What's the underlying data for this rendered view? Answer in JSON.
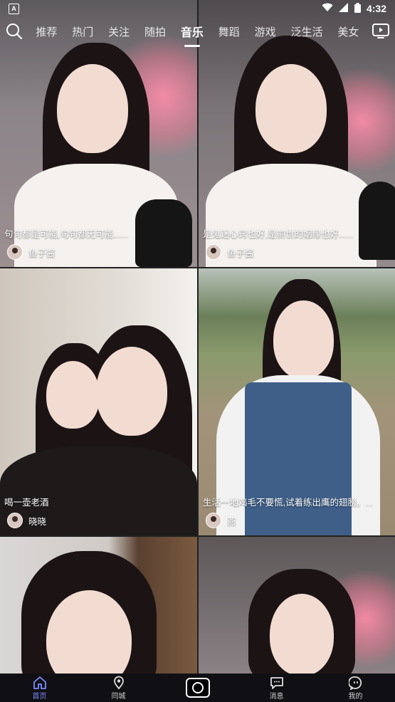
{
  "status_bar": {
    "app_badge": "A",
    "time": "4:32"
  },
  "top_nav": {
    "tabs": [
      "推荐",
      "热门",
      "关注",
      "随拍",
      "音乐",
      "舞蹈",
      "游戏",
      "泛生活",
      "美女"
    ],
    "active_tab": "音乐"
  },
  "feed": [
    {
      "caption": "句句都是可能,句句都无可能......",
      "author": "鱼子酱"
    },
    {
      "caption": "是鬼迷心窍也好,是前世的姻缘也好......",
      "author": "鱼子酱"
    },
    {
      "caption": "喝一壶老酒",
      "author": "晓晓"
    },
    {
      "caption": "生活一地鸡毛不要慌,试着练出鹰的翅膀。...",
      "author": "燕"
    },
    {
      "caption": "",
      "author": ""
    },
    {
      "caption": "",
      "author": ""
    }
  ],
  "bottom_nav": {
    "items": [
      {
        "label": "首页",
        "icon": "home-icon",
        "active": true
      },
      {
        "label": "同城",
        "icon": "location-icon",
        "active": false
      },
      {
        "label": "",
        "icon": "camera-icon",
        "active": false
      },
      {
        "label": "消息",
        "icon": "message-icon",
        "active": false
      },
      {
        "label": "我的",
        "icon": "profile-icon",
        "active": false
      }
    ]
  },
  "colors": {
    "accent": "#7b8cff",
    "bar_bg": "#101014"
  }
}
